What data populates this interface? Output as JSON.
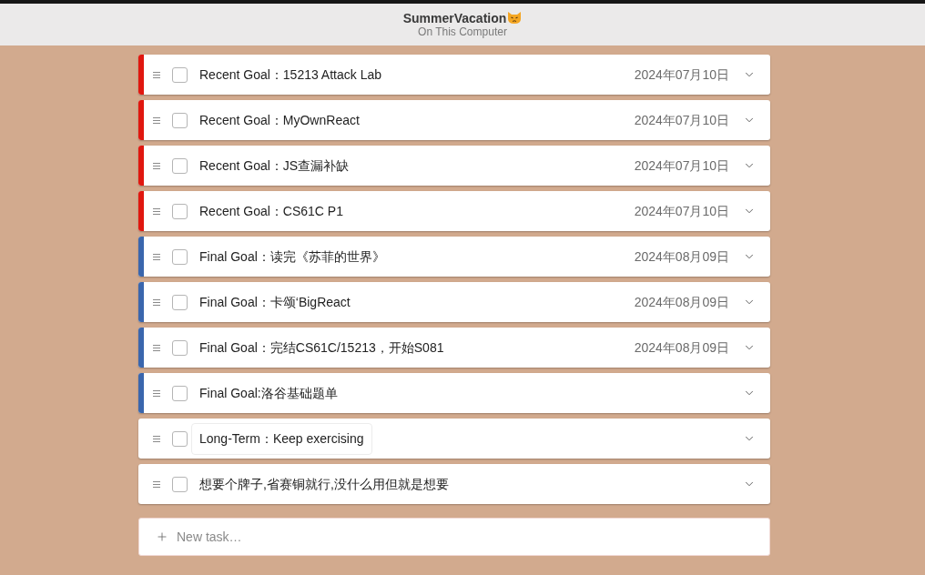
{
  "header": {
    "title": "SummerVacation",
    "subtitle": "On This Computer"
  },
  "tasks": [
    {
      "text": "Recent Goal：15213 Attack Lab",
      "date": "2024年07月10日",
      "color": "#e0170f",
      "checked": false,
      "focused": false
    },
    {
      "text": "Recent Goal：MyOwnReact",
      "date": "2024年07月10日",
      "color": "#e0170f",
      "checked": false,
      "focused": false
    },
    {
      "text": "Recent Goal：JS查漏补缺",
      "date": "2024年07月10日",
      "color": "#e0170f",
      "checked": false,
      "focused": false
    },
    {
      "text": "Recent Goal：CS61C P1",
      "date": "2024年07月10日",
      "color": "#e0170f",
      "checked": false,
      "focused": false
    },
    {
      "text": "Final Goal：读完《苏菲的世界》",
      "date": "2024年08月09日",
      "color": "#3a66ad",
      "checked": false,
      "focused": false
    },
    {
      "text": "Final Goal：卡颂‘BigReact",
      "date": "2024年08月09日",
      "color": "#3a66ad",
      "checked": false,
      "focused": false
    },
    {
      "text": "Final Goal：完结CS61C/15213，开始S081",
      "date": "2024年08月09日",
      "color": "#3a66ad",
      "checked": false,
      "focused": false
    },
    {
      "text": "Final Goal:洛谷基础题单",
      "color": "#3a66ad",
      "checked": false,
      "focused": false
    },
    {
      "text": "Long-Term：Keep exercising",
      "checked": false,
      "focused": true
    },
    {
      "text": "想要个牌子,省赛铜就行,没什么用但就是想要",
      "checked": false,
      "focused": false
    }
  ],
  "new_task": {
    "placeholder": "New task…"
  }
}
